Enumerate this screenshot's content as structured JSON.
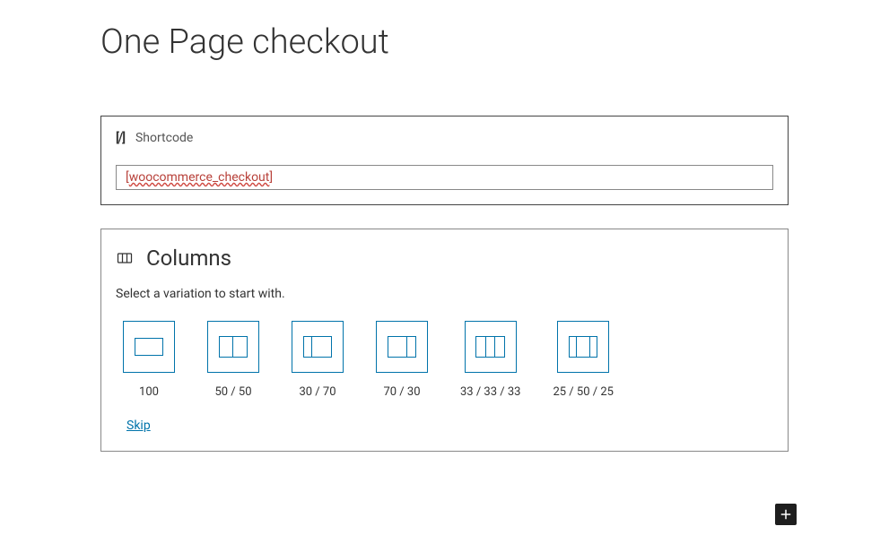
{
  "page": {
    "title": "One Page checkout"
  },
  "shortcode_block": {
    "label": "Shortcode",
    "icon_text": "[/]",
    "value": "[woocommerce_checkout]"
  },
  "columns_block": {
    "title": "Columns",
    "description": "Select a variation to start with.",
    "variations": [
      {
        "label": "100"
      },
      {
        "label": "50 / 50"
      },
      {
        "label": "30 / 70"
      },
      {
        "label": "70 / 30"
      },
      {
        "label": "33 / 33 / 33"
      },
      {
        "label": "25 / 50 / 25"
      }
    ],
    "skip_label": "Skip"
  }
}
